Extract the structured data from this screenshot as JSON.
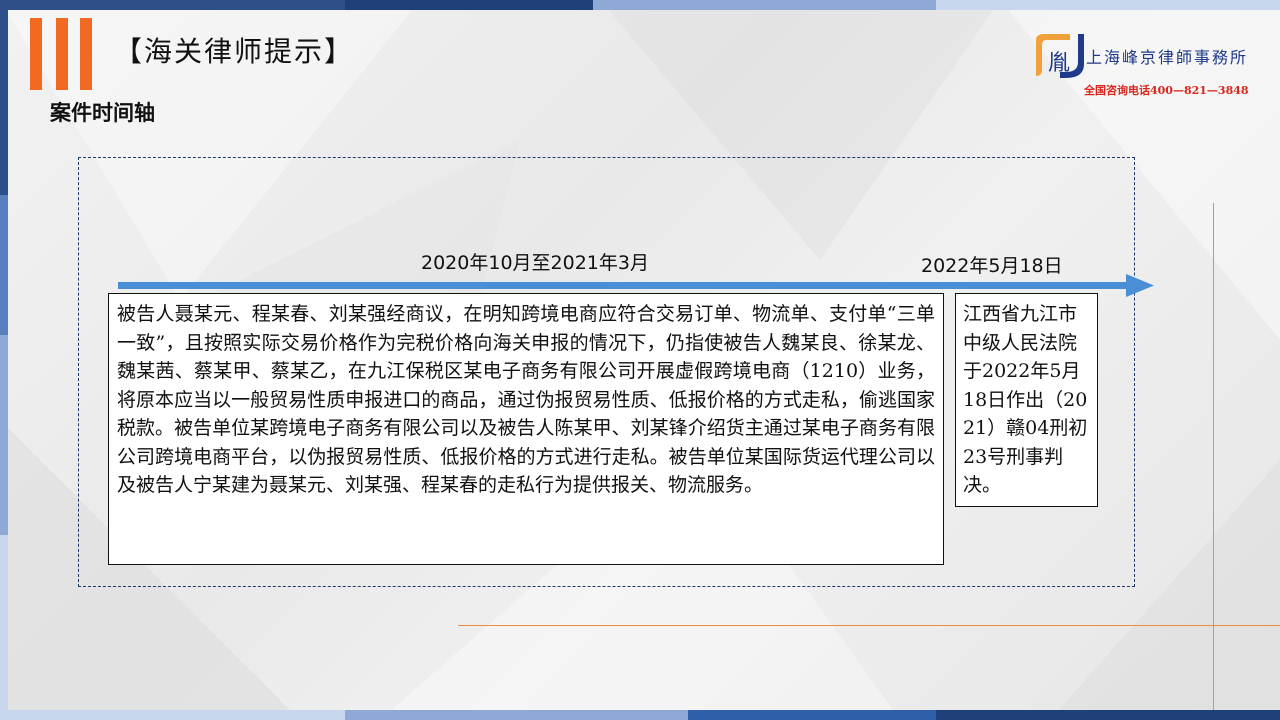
{
  "header": {
    "title": "【海关律师提示】",
    "subtitle": "案件时间轴"
  },
  "logo": {
    "mark_char": "胤",
    "name": "上海峰京律師事務所",
    "phone": "全国咨询电话400—821—3848"
  },
  "timeline": {
    "date_1": "2020年10月至2021年3月",
    "date_2": "2022年5月18日",
    "event_1_text": "被告人聂某元、程某春、刘某强经商议，在明知跨境电商应符合交易订单、物流单、支付单“三单一致”，且按照实际交易价格作为完税价格向海关申报的情况下，仍指使被告人魏某良、徐某龙、魏某茜、蔡某甲、蔡某乙，在九江保税区某电子商务有限公司开展虚假跨境电商（1210）业务，将原本应当以一般贸易性质申报进口的商品，通过伪报贸易性质、低报价格的方式走私，偷逃国家税款。被告单位某跨境电子商务有限公司以及被告人陈某甲、刘某锋介绍货主通过某电子商务有限公司跨境电商平台，以伪报贸易性质、低报价格的方式进行走私。被告单位某国际货运代理公司以及被告人宁某建为聂某元、刘某强、程某春的走私行为提供报关、物流服务。",
    "event_2_text": "江西省九江市中级人民法院于2022年5月18日作出（2021）赣04刑初23号刑事判决。"
  },
  "colors": {
    "accent_orange": "#f26a21",
    "arrow_blue": "#4a8fd6",
    "brand_blue": "#1f3a8a",
    "phone_red": "#d7261e"
  }
}
